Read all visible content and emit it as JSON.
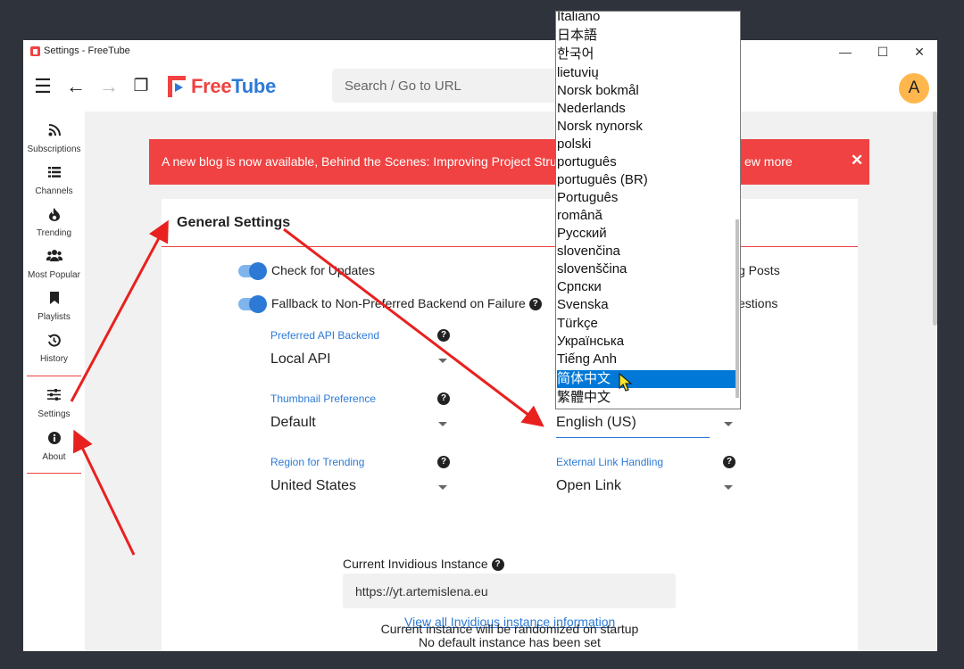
{
  "window": {
    "title": "Settings - FreeTube",
    "controls": [
      "—",
      "☐",
      "✕"
    ]
  },
  "topbar": {
    "logo_free": "Free",
    "logo_tube": "Tube",
    "search_placeholder": "Search / Go to URL",
    "avatar_letter": "A",
    "icons": {
      "menu": "☰",
      "back": "←",
      "forward": "→",
      "new_window": "❐"
    }
  },
  "sidebar": {
    "items": [
      {
        "label": "Subscriptions",
        "icon": "rss-icon"
      },
      {
        "label": "Channels",
        "icon": "list-icon"
      },
      {
        "label": "Trending",
        "icon": "fire-icon"
      },
      {
        "label": "Most Popular",
        "icon": "users-icon"
      },
      {
        "label": "Playlists",
        "icon": "bookmark-icon"
      },
      {
        "label": "History",
        "icon": "history-icon"
      },
      {
        "label": "Settings",
        "icon": "sliders-icon"
      },
      {
        "label": "About",
        "icon": "info-icon"
      }
    ]
  },
  "banner": {
    "text": "A new blog is now available, Behind the Scenes: Improving Project Struct",
    "text_tail": "ew more",
    "close": "✕"
  },
  "general_settings": {
    "title": "General Settings",
    "check_updates": "Check for Updates",
    "check_updates_on": true,
    "fallback": "Fallback to Non-Preferred Backend on Failure",
    "fallback_on": true,
    "right_option_1": "g Posts",
    "right_option_2": "estions",
    "preferred_backend_label": "Preferred API Backend",
    "preferred_backend_value": "Local API",
    "thumbnail_label": "Thumbnail Preference",
    "thumbnail_value": "Default",
    "region_label": "Region for Trending",
    "region_value": "United States",
    "locale_value": "English (US)",
    "external_link_label": "External Link Handling",
    "external_link_value": "Open Link",
    "help_glyph": "?"
  },
  "invidious": {
    "label": "Current Invidious Instance",
    "value": "https://yt.artemislena.eu",
    "link": "View all Invidious instance information",
    "note1": "No default instance has been set",
    "note2": "Current instance will be randomized on startup"
  },
  "dropdown": {
    "options": [
      "Italiano",
      "日本語",
      "한국어",
      "lietuvių",
      "Norsk bokmål",
      "Nederlands",
      "Norsk nynorsk",
      "polski",
      "português",
      "português (BR)",
      "Português",
      "română",
      "Русский",
      "slovenčina",
      "slovenščina",
      "Српски",
      "Svenska",
      "Türkçe",
      "Українська",
      "Tiếng Anh",
      "简体中文",
      "繁體中文"
    ],
    "selected": "简体中文"
  },
  "colors": {
    "accent": "#f04242",
    "primary": "#2d7ad6",
    "annotation": "#e8211f"
  }
}
